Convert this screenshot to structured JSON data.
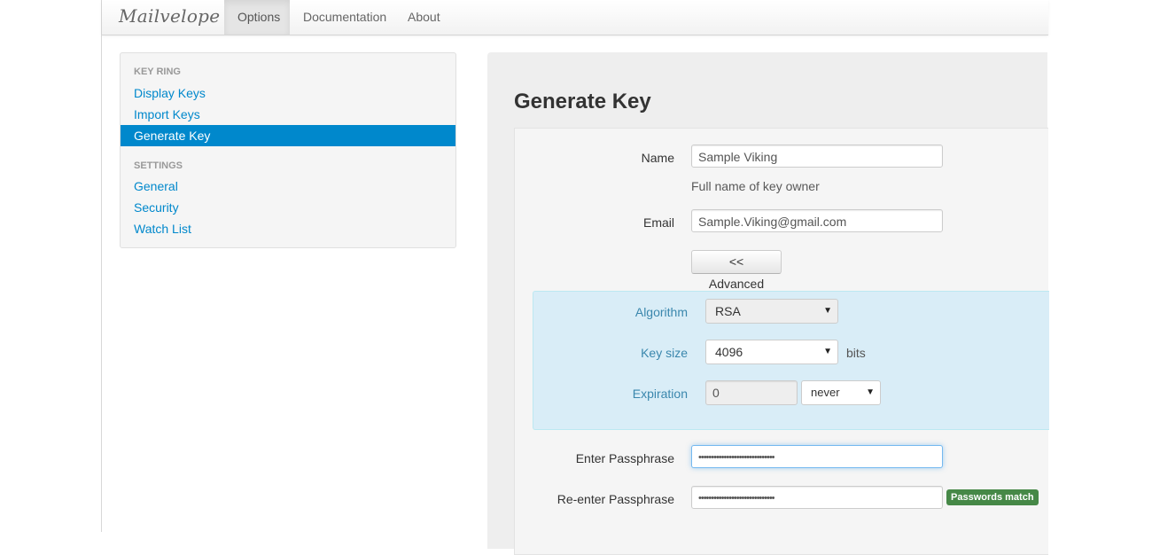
{
  "navbar": {
    "brand": "Mailvelope",
    "items": [
      {
        "label": "Options",
        "active": true
      },
      {
        "label": "Documentation",
        "active": false
      },
      {
        "label": "About",
        "active": false
      }
    ]
  },
  "sidebar": {
    "sections": [
      {
        "header": "KEY RING",
        "items": [
          {
            "label": "Display Keys",
            "active": false
          },
          {
            "label": "Import Keys",
            "active": false
          },
          {
            "label": "Generate Key",
            "active": true
          }
        ]
      },
      {
        "header": "SETTINGS",
        "items": [
          {
            "label": "General",
            "active": false
          },
          {
            "label": "Security",
            "active": false
          },
          {
            "label": "Watch List",
            "active": false
          }
        ]
      }
    ]
  },
  "main": {
    "title": "Generate Key",
    "form": {
      "name_label": "Name",
      "name_value": "Sample Viking",
      "name_help": "Full name of key owner",
      "email_label": "Email",
      "email_value": "Sample.Viking@gmail.com",
      "advanced_button": "<< Advanced",
      "algorithm_label": "Algorithm",
      "algorithm_value": "RSA",
      "keysize_label": "Key size",
      "keysize_value": "4096",
      "keysize_unit": "bits",
      "expiration_label": "Expiration",
      "expiration_value": "0",
      "expiration_unit": "never",
      "passphrase_label": "Enter Passphrase",
      "passphrase_value": "••••••••••••••••••••••••••••••",
      "repassphrase_label": "Re-enter Passphrase",
      "repassphrase_value": "••••••••••••••••••••••••••••••",
      "match_badge": "Passwords match"
    }
  },
  "colors": {
    "link": "#0088cc",
    "advanced_bg": "#d9edf7",
    "advanced_label": "#3a87ad",
    "success": "#468847"
  }
}
